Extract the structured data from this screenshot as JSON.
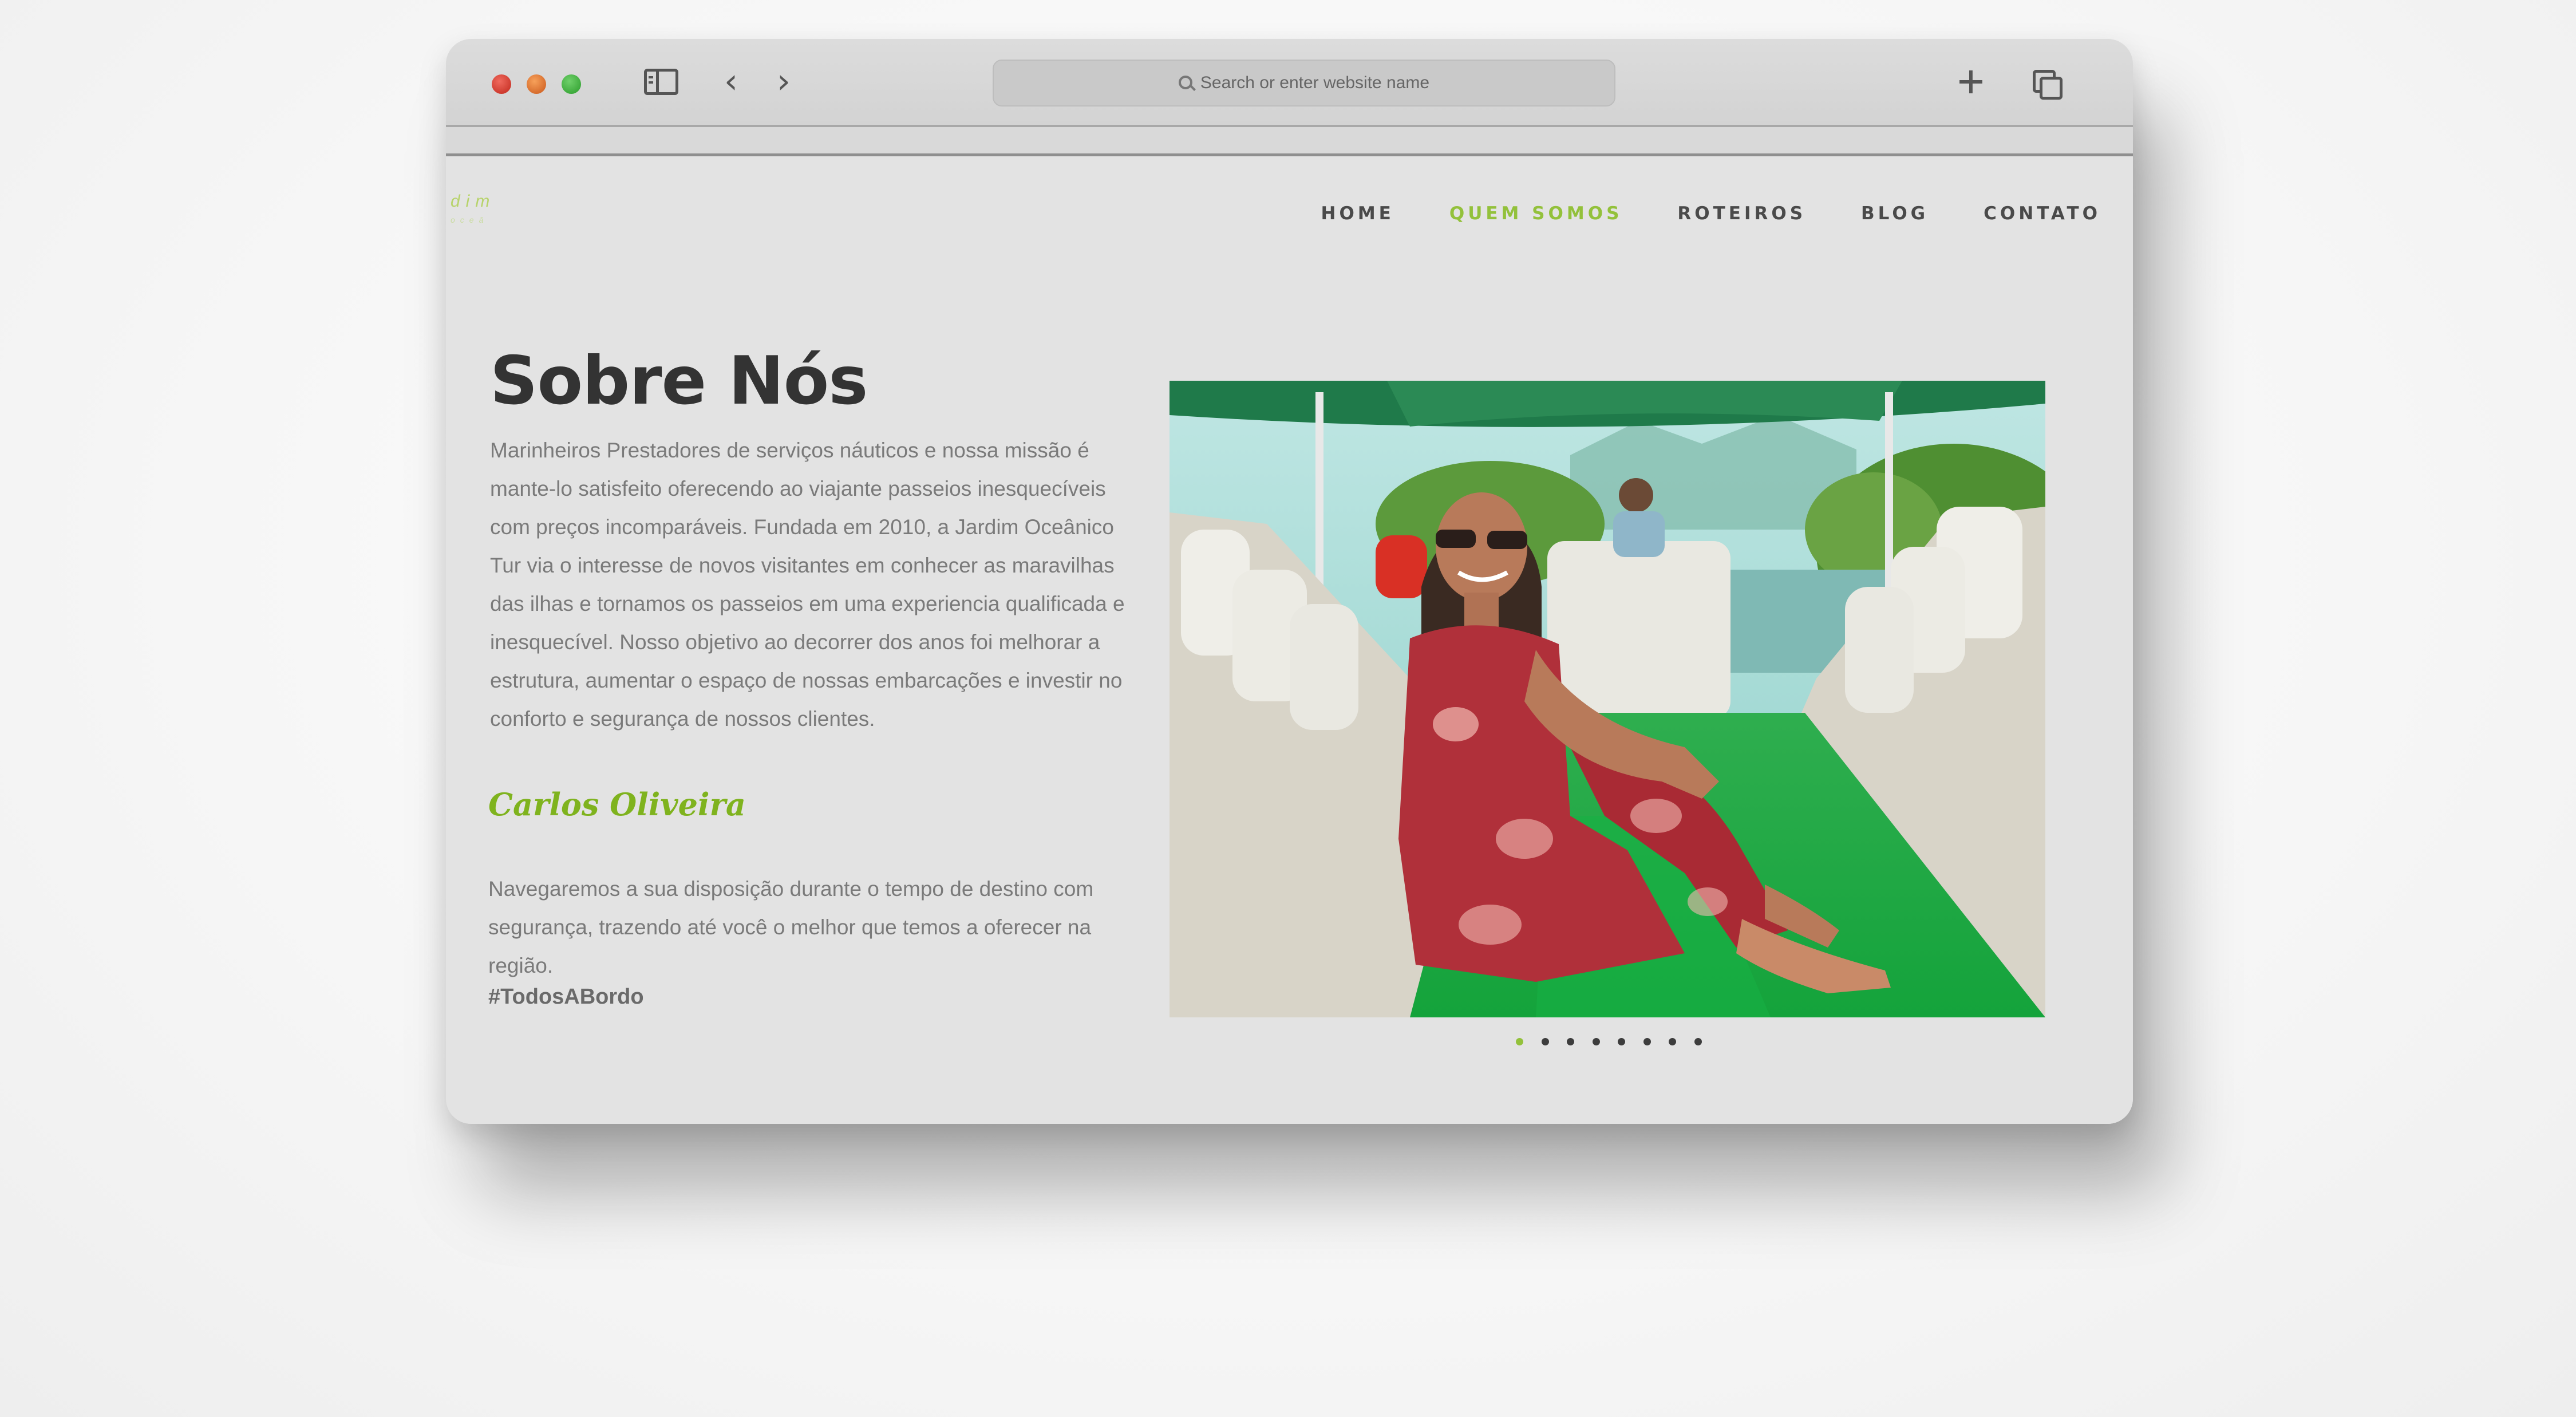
{
  "browser": {
    "url_placeholder": "Search or enter website name"
  },
  "site": {
    "logo_text": "dim",
    "logo_subtext": "oceâ",
    "nav": [
      {
        "label": "HOME",
        "active": false
      },
      {
        "label": "QUEM SOMOS",
        "active": true
      },
      {
        "label": "ROTEIROS",
        "active": false
      },
      {
        "label": "BLOG",
        "active": false
      },
      {
        "label": "CONTATO",
        "active": false
      }
    ],
    "accent_color": "#93c13b"
  },
  "about": {
    "title": "Sobre Nós",
    "paragraph": "Marinheiros Prestadores de serviços náuticos e nossa missão é mante-lo satisfeito oferecendo ao viajante passeios inesquecíveis com preços incomparáveis. Fundada em 2010, a Jardim Oceânico Tur via o interesse de novos visitantes em conhecer as maravilhas das ilhas e tornamos os passeios em uma experiencia qualificada e inesquecível. Nosso objetivo ao decorrer dos anos foi melhorar a estrutura, aumentar o espaço de nossas embarcações e investir no conforto e segurança de nossos clientes.",
    "signature": "Carlos Oliveira",
    "closing": "Navegaremos a sua disposição durante o tempo de destino com segurança, trazendo até você o melhor que temos a oferecer na região.",
    "hashtag": "#TodosABordo"
  },
  "carousel": {
    "slide_count": 8,
    "active_index": 0
  }
}
